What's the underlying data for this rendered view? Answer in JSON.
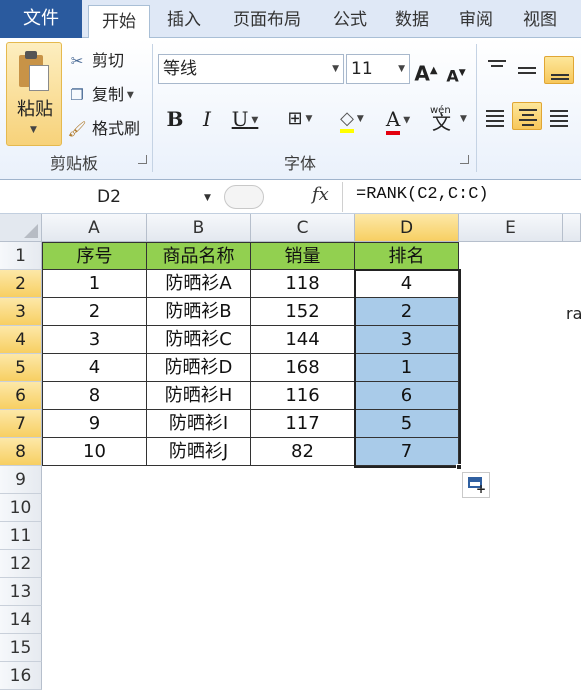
{
  "tabs": {
    "file": "文件",
    "home": "开始",
    "insert": "插入",
    "page_layout": "页面布局",
    "formulas": "公式",
    "data": "数据",
    "review": "审阅",
    "view": "视图"
  },
  "clipboard": {
    "paste": "粘贴",
    "cut": "剪切",
    "copy": "复制",
    "format_painter": "格式刷",
    "group_label": "剪贴板"
  },
  "font": {
    "name": "等线",
    "size": "11",
    "bold": "B",
    "italic": "I",
    "underline": "U",
    "font_color": "A",
    "grow": "A",
    "shrink": "A",
    "phonetic_top": "wén",
    "phonetic_main": "文",
    "group_label": "字体"
  },
  "formula_bar": {
    "name_box": "D2",
    "fx": "fx",
    "formula": "=RANK(C2,C:C)"
  },
  "columns": [
    "A",
    "B",
    "C",
    "D",
    "E"
  ],
  "rows": [
    "1",
    "2",
    "3",
    "4",
    "5",
    "6",
    "7",
    "8",
    "9",
    "10",
    "11",
    "12",
    "13",
    "14",
    "15",
    "16"
  ],
  "table": {
    "headers": [
      "序号",
      "商品名称",
      "销量",
      "排名"
    ],
    "rows": [
      [
        "1",
        "防晒衫A",
        "118",
        "4"
      ],
      [
        "2",
        "防晒衫B",
        "152",
        "2"
      ],
      [
        "3",
        "防晒衫C",
        "144",
        "3"
      ],
      [
        "4",
        "防晒衫D",
        "168",
        "1"
      ],
      [
        "8",
        "防晒衫H",
        "116",
        "6"
      ],
      [
        "9",
        "防晒衫I",
        "117",
        "5"
      ],
      [
        "10",
        "防晒衫J",
        "82",
        "7"
      ]
    ]
  },
  "stray_text": "ra",
  "colors": {
    "header_fill": "#92d050",
    "rank_highlight": "#a9cbe9",
    "file_tab": "#2a5a9e",
    "selected_header": "#f7cf62"
  }
}
